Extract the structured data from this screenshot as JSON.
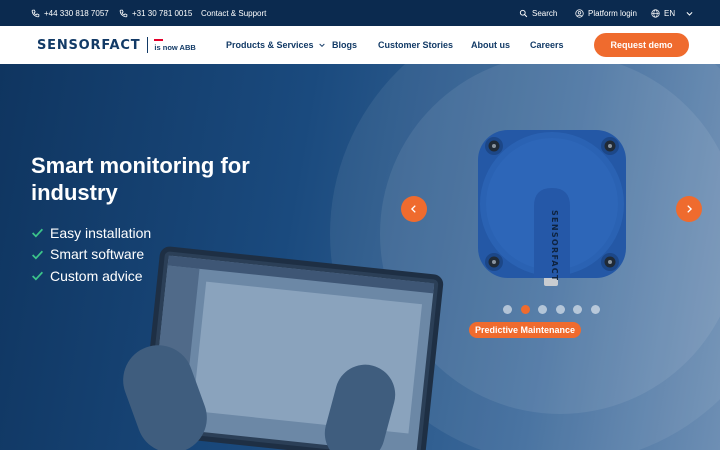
{
  "topbar": {
    "phone_uk": "+44 330 818 7057",
    "phone_nl": "+31 30 781 0015",
    "contact": "Contact & Support",
    "search": "Search",
    "platform_login": "Platform login",
    "language": "EN"
  },
  "nav": {
    "logo_word": "SENSORFACT",
    "logo_sub": "is now ABB",
    "items": [
      {
        "label": "Products & Services"
      },
      {
        "label": "Blogs"
      },
      {
        "label": "Customer Stories"
      },
      {
        "label": "About us"
      },
      {
        "label": "Careers"
      }
    ],
    "cta": "Request demo"
  },
  "hero": {
    "title": "Smart monitoring for industry",
    "features": [
      "Easy installation",
      "Smart software",
      "Custom advice"
    ],
    "sensor_text": "SENSORFACT",
    "slide_label": "Predictive Maintenance",
    "slide_count": 6,
    "active_slide": 2
  },
  "colors": {
    "navy": "#0b2a4f",
    "brand_blue": "#123a66",
    "accent_orange": "#ef6b2e",
    "check_green": "#3cc58a",
    "sensor_blue": "#2a62b3"
  },
  "icons": {
    "phone": "phone-icon",
    "search": "search-icon",
    "user": "user-icon",
    "globe": "globe-icon",
    "chevron": "chevron-down-icon",
    "check": "check-icon",
    "prev": "chevron-left-icon",
    "next": "chevron-right-icon"
  }
}
